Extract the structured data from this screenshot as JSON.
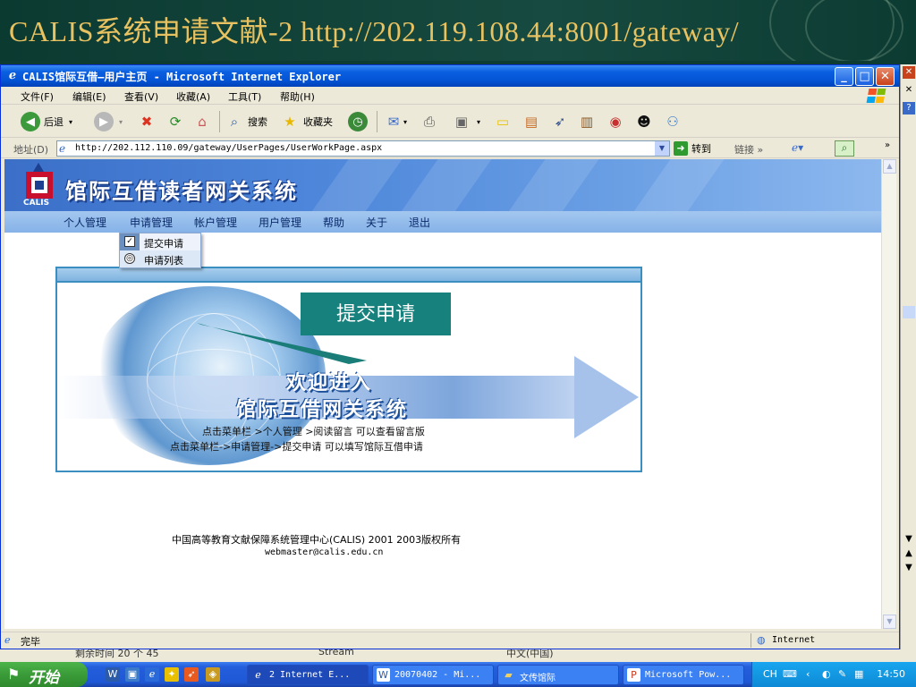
{
  "slide": {
    "title": "CALIS系统申请文献-2 http://202.119.108.44:8001/gateway/"
  },
  "window": {
    "title": "CALIS馆际互借—用户主页 - Microsoft Internet Explorer",
    "min_icon": "minimize-icon",
    "max_icon": "maximize-icon",
    "close_icon": "close-icon"
  },
  "menu": {
    "items": [
      "文件(F)",
      "编辑(E)",
      "查看(V)",
      "收藏(A)",
      "工具(T)",
      "帮助(H)"
    ]
  },
  "toolbar": {
    "back": "后退",
    "search": "搜索",
    "favorites": "收藏夹"
  },
  "address": {
    "label": "地址(D)",
    "url": "http://202.112.110.09/gateway/UserPages/UserWorkPage.aspx",
    "go": "转到",
    "links": "链接 »"
  },
  "site": {
    "logo_text": "CALIS",
    "title": "馆际互借读者网关系统",
    "nav": [
      "个人管理",
      "申请管理",
      "帐户管理",
      "用户管理",
      "帮助",
      "关于",
      "退出"
    ]
  },
  "dropdown": {
    "items": [
      "提交申请",
      "申请列表"
    ]
  },
  "welcome": {
    "line1": "欢迎进入",
    "line2": "馆际互借网关系统",
    "instruction1": "点击菜单栏 >个人管理 >阅读留言 可以查看留言版",
    "instruction2": "点击菜单栏->申请管理->提交申请 可以填写馆际互借申请"
  },
  "callout": {
    "text": "提交申请"
  },
  "footer": {
    "copyright": "中国高等教育文献保障系统管理中心(CALIS) 2001 2003版权所有",
    "email": "webmaster@calis.edu.cn"
  },
  "status": {
    "text": "完毕",
    "zone": "Internet"
  },
  "bg_strip": {
    "left": "剩余时间 20 个 45",
    "middle": "Stream",
    "right": "中文(中国)"
  },
  "taskbar": {
    "start": "开始",
    "tasks": [
      "2 Internet E...",
      "20070402 - Mi...",
      "文传馆际",
      "Microsoft Pow..."
    ],
    "tray_lang": "CH",
    "clock": "14:50"
  },
  "colors": {
    "xp_blue": "#0454d6",
    "callout_teal": "#17827d",
    "slide_title_gold": "#e8c260",
    "site_header_blue": "#4d86da"
  }
}
